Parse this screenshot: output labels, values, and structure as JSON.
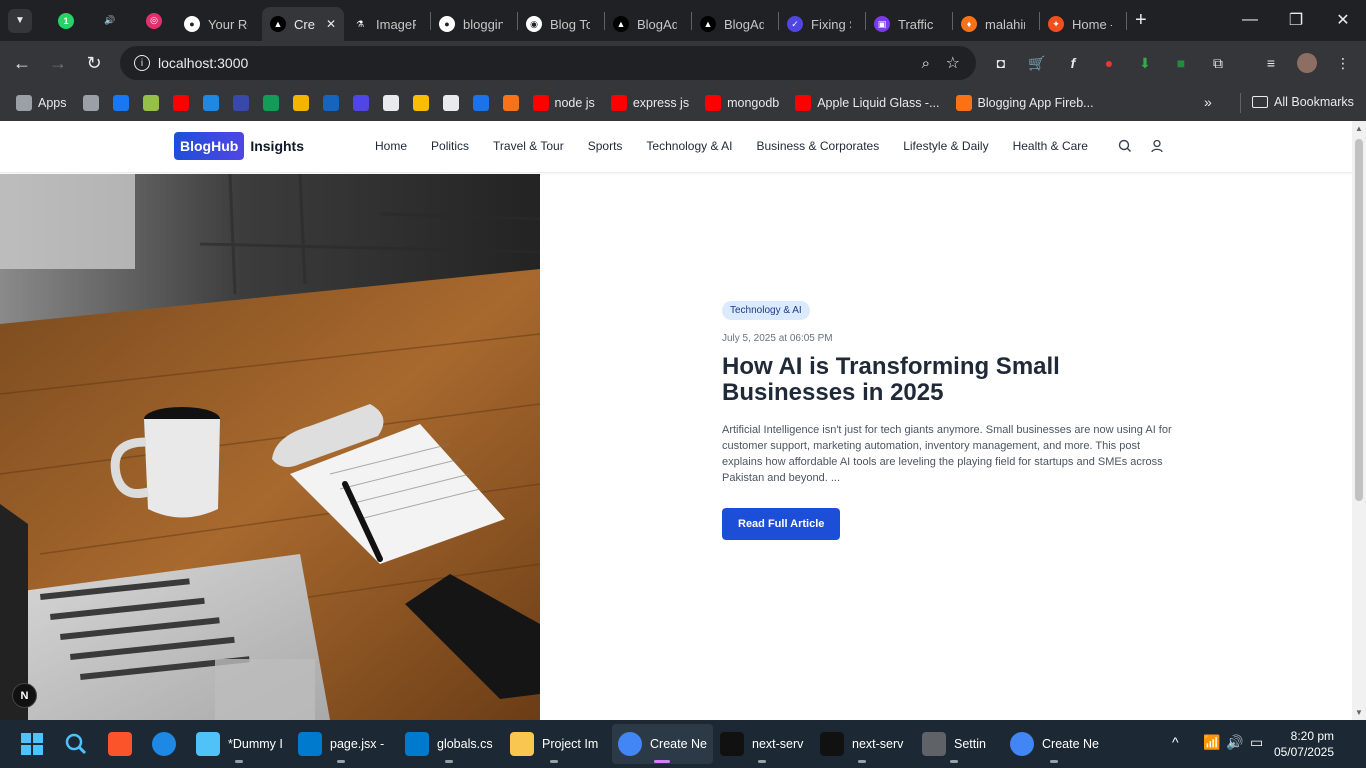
{
  "browser": {
    "tabs": [
      {
        "label": "",
        "fav_color": "#25d366",
        "fav_glyph": "1"
      },
      {
        "label": "",
        "fav_color": "#202124",
        "fav_glyph": "🔊"
      },
      {
        "label": "",
        "fav_color": "#e1306c",
        "fav_glyph": "◎"
      },
      {
        "label": "Your Re",
        "fav_color": "#ffffff",
        "fav_glyph": "●"
      },
      {
        "label": "Cre",
        "fav_color": "#000000",
        "fav_glyph": "▲",
        "active": true
      },
      {
        "label": "ImageF",
        "fav_color": "#202124",
        "fav_glyph": "⚗"
      },
      {
        "label": "bloggin",
        "fav_color": "#ffffff",
        "fav_glyph": "●"
      },
      {
        "label": "Blog To",
        "fav_color": "#ffffff",
        "fav_glyph": "◉"
      },
      {
        "label": "BlogAd",
        "fav_color": "#000000",
        "fav_glyph": "▲"
      },
      {
        "label": "BlogAd",
        "fav_color": "#000000",
        "fav_glyph": "▲"
      },
      {
        "label": "Fixing S",
        "fav_color": "#4f46e5",
        "fav_glyph": "✓"
      },
      {
        "label": "Traffic R",
        "fav_color": "#7c3aed",
        "fav_glyph": "▣"
      },
      {
        "label": "malahin",
        "fav_color": "#f97316",
        "fav_glyph": "♦"
      },
      {
        "label": "Home -",
        "fav_color": "#f24e1e",
        "fav_glyph": "✦"
      }
    ],
    "new_tab": "+",
    "url": "localhost:3000",
    "bookmarks": [
      {
        "label": "Apps",
        "color": "#9aa0a6"
      },
      {
        "label": "",
        "color": "#9aa0a6"
      },
      {
        "label": "",
        "color": "#1877f2"
      },
      {
        "label": "",
        "color": "#95bf47"
      },
      {
        "label": "",
        "color": "#ff0000"
      },
      {
        "label": "",
        "color": "#1e88e5"
      },
      {
        "label": "",
        "color": "#3949ab"
      },
      {
        "label": "",
        "color": "#0f9d58"
      },
      {
        "label": "",
        "color": "#f4b400"
      },
      {
        "label": "",
        "color": "#1565c0"
      },
      {
        "label": "",
        "color": "#4f46e5"
      },
      {
        "label": "",
        "color": "#e8eaed"
      },
      {
        "label": "",
        "color": "#fbbc04"
      },
      {
        "label": "",
        "color": "#e8eaed"
      },
      {
        "label": "",
        "color": "#1a73e8"
      },
      {
        "label": "",
        "color": "#f97316"
      },
      {
        "label": "node js",
        "color": "#ff0000"
      },
      {
        "label": "express js",
        "color": "#ff0000"
      },
      {
        "label": "mongodb",
        "color": "#ff0000"
      },
      {
        "label": "Apple Liquid Glass -...",
        "color": "#ff0000"
      },
      {
        "label": "Blogging App Fireb...",
        "color": "#f97316"
      }
    ],
    "all_bookmarks": "All Bookmarks"
  },
  "site": {
    "logo_badge": "BlogHub",
    "logo_name": "Insights",
    "nav": [
      "Home",
      "Politics",
      "Travel & Tour",
      "Sports",
      "Technology & AI",
      "Business & Corporates",
      "Lifestyle & Daily",
      "Health & Care"
    ]
  },
  "hero": {
    "category": "Technology & AI",
    "date": "July 5, 2025 at 06:05 PM",
    "title": "How AI is Transforming Small Businesses in 2025",
    "excerpt": "Artificial Intelligence isn't just for tech giants anymore. Small businesses are now using AI for customer support, marketing automation, inventory management, and more. This post explains how affordable AI tools are leveling the playing field for startups and SMEs across Pakistan and beyond. ...",
    "button": "Read Full Article",
    "next_badge": "N"
  },
  "taskbar": {
    "items": [
      {
        "label": "*Dummy I",
        "color": "#4fc3f7"
      },
      {
        "label": "page.jsx -",
        "color": "#007acc"
      },
      {
        "label": "globals.cs",
        "color": "#007acc"
      },
      {
        "label": "Project Im",
        "color": "#f9c74f"
      },
      {
        "label": "Create Ne",
        "color": "#4285f4"
      },
      {
        "label": "next-serv",
        "color": "#111111"
      },
      {
        "label": "next-serv",
        "color": "#111111"
      },
      {
        "label": "Settin",
        "color": "#5f6368"
      },
      {
        "label": "Create Ne",
        "color": "#4285f4"
      }
    ],
    "time": "8:20 pm",
    "date": "05/07/2025"
  }
}
